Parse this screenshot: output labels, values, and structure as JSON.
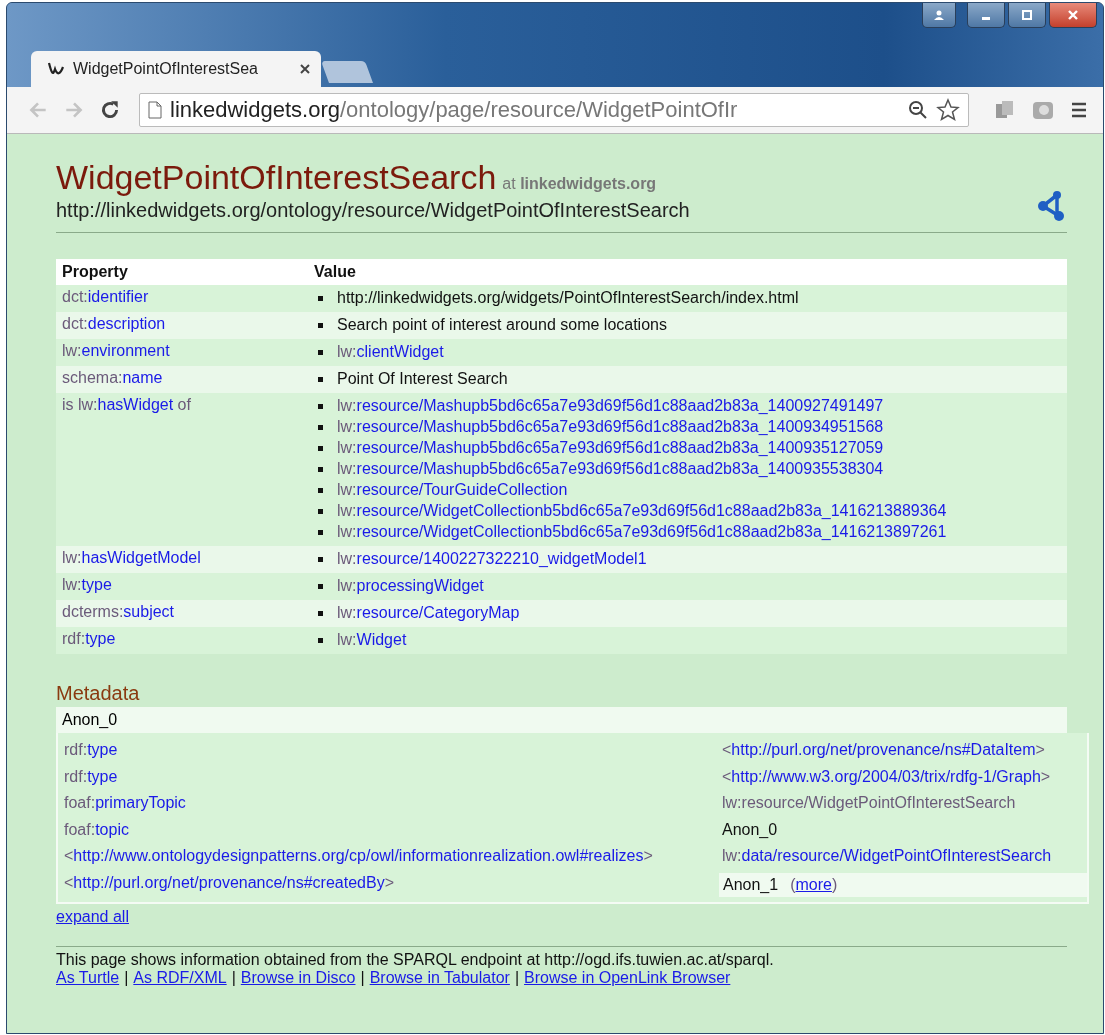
{
  "browser": {
    "tabs": [
      {
        "kind": "page",
        "title": "WidgetPointOfInterestSea",
        "selected": true
      },
      {
        "kind": "new",
        "selected": false
      }
    ],
    "address": {
      "host": "linkedwidgets.org",
      "path": "/ontology/page/resource/WidgetPointOfIr"
    }
  },
  "page": {
    "title": "WidgetPointOfInterestSearch",
    "at_label": "at",
    "site": "linkedwidgets.org",
    "uri": "http://linkedwidgets.org/ontology/resource/WidgetPointOfInterestSearch",
    "table": {
      "columns": [
        "Property",
        "Value"
      ],
      "rows": [
        {
          "property": {
            "prefix": "dct:",
            "local": "identifier"
          },
          "values": [
            {
              "kind": "text",
              "text": "http://linkedwidgets.org/widgets/PointOfInterestSearch/index.html"
            }
          ]
        },
        {
          "property": {
            "prefix": "dct:",
            "local": "description"
          },
          "values": [
            {
              "kind": "text",
              "text": "Search point of interest around some locations"
            }
          ]
        },
        {
          "property": {
            "prefix": "lw:",
            "local": "environment"
          },
          "values": [
            {
              "kind": "term",
              "prefix": "lw:",
              "local": "clientWidget"
            }
          ]
        },
        {
          "property": {
            "prefix": "schema:",
            "local": "name"
          },
          "values": [
            {
              "kind": "text",
              "text": "Point Of Interest Search"
            }
          ]
        },
        {
          "property": {
            "prefix": "is lw:",
            "local": "hasWidget",
            "suffix": " of"
          },
          "values": [
            {
              "kind": "term",
              "prefix": "lw:",
              "local": "resource/Mashupb5bd6c65a7e93d69f56d1c88aad2b83a_1400927491497"
            },
            {
              "kind": "term",
              "prefix": "lw:",
              "local": "resource/Mashupb5bd6c65a7e93d69f56d1c88aad2b83a_1400934951568"
            },
            {
              "kind": "term",
              "prefix": "lw:",
              "local": "resource/Mashupb5bd6c65a7e93d69f56d1c88aad2b83a_1400935127059"
            },
            {
              "kind": "term",
              "prefix": "lw:",
              "local": "resource/Mashupb5bd6c65a7e93d69f56d1c88aad2b83a_1400935538304"
            },
            {
              "kind": "term",
              "prefix": "lw:",
              "local": "resource/TourGuideCollection"
            },
            {
              "kind": "term",
              "prefix": "lw:",
              "local": "resource/WidgetCollectionb5bd6c65a7e93d69f56d1c88aad2b83a_1416213889364"
            },
            {
              "kind": "term",
              "prefix": "lw:",
              "local": "resource/WidgetCollectionb5bd6c65a7e93d69f56d1c88aad2b83a_1416213897261"
            }
          ]
        },
        {
          "property": {
            "prefix": "lw:",
            "local": "hasWidgetModel"
          },
          "values": [
            {
              "kind": "term",
              "prefix": "lw:",
              "local": "resource/1400227322210_widgetModel1"
            }
          ]
        },
        {
          "property": {
            "prefix": "lw:",
            "local": "type"
          },
          "values": [
            {
              "kind": "term",
              "prefix": "lw:",
              "local": "processingWidget"
            }
          ]
        },
        {
          "property": {
            "prefix": "dcterms:",
            "local": "subject"
          },
          "values": [
            {
              "kind": "term",
              "prefix": "lw:",
              "local": "resource/CategoryMap"
            }
          ]
        },
        {
          "property": {
            "prefix": "rdf:",
            "local": "type"
          },
          "values": [
            {
              "kind": "term",
              "prefix": "lw:",
              "local": "Widget"
            }
          ]
        }
      ]
    },
    "metadata": {
      "heading": "Metadata",
      "subject": "Anon_0",
      "rows": [
        {
          "property": {
            "kind": "term",
            "prefix": "rdf:",
            "local": "type"
          },
          "value": {
            "kind": "uri",
            "before": "<",
            "uri": "http://purl.org/net/provenance/ns#DataItem",
            "after": ">"
          }
        },
        {
          "property": {
            "kind": "term",
            "prefix": "rdf:",
            "local": "type"
          },
          "value": {
            "kind": "uri",
            "before": "<",
            "uri": "http://www.w3.org/2004/03/trix/rdfg-1/Graph",
            "after": ">"
          }
        },
        {
          "property": {
            "kind": "term",
            "prefix": "foaf:",
            "local": "primaryTopic"
          },
          "value": {
            "kind": "term",
            "prefix": "lw:",
            "local": "resource/WidgetPointOfInterestSearch",
            "visited": true
          }
        },
        {
          "property": {
            "kind": "term",
            "prefix": "foaf:",
            "local": "topic"
          },
          "value": {
            "kind": "text",
            "text": "Anon_0"
          }
        },
        {
          "property": {
            "kind": "uri",
            "before": "<",
            "uri": "http://www.ontologydesignpatterns.org/cp/owl/informationrealization.owl#realizes",
            "after": ">"
          },
          "value": {
            "kind": "term",
            "prefix": "lw:",
            "local": "data/resource/WidgetPointOfInterestSearch",
            "visited": false
          }
        },
        {
          "property": {
            "kind": "uri",
            "before": "<",
            "uri": "http://purl.org/net/provenance/ns#createdBy",
            "after": ">"
          },
          "value": {
            "kind": "anon",
            "text": "Anon_1",
            "open": "(",
            "more": "more",
            "close": ")"
          }
        }
      ]
    },
    "expand_all": "expand all",
    "footer": {
      "text": "This page shows information obtained from the SPARQL endpoint at http://ogd.ifs.tuwien.ac.at/sparql.",
      "separator": "|",
      "links": [
        "As Turtle",
        "As RDF/XML",
        "Browse in Disco",
        "Browse in Tabulator",
        "Browse in OpenLink Browser"
      ]
    }
  }
}
